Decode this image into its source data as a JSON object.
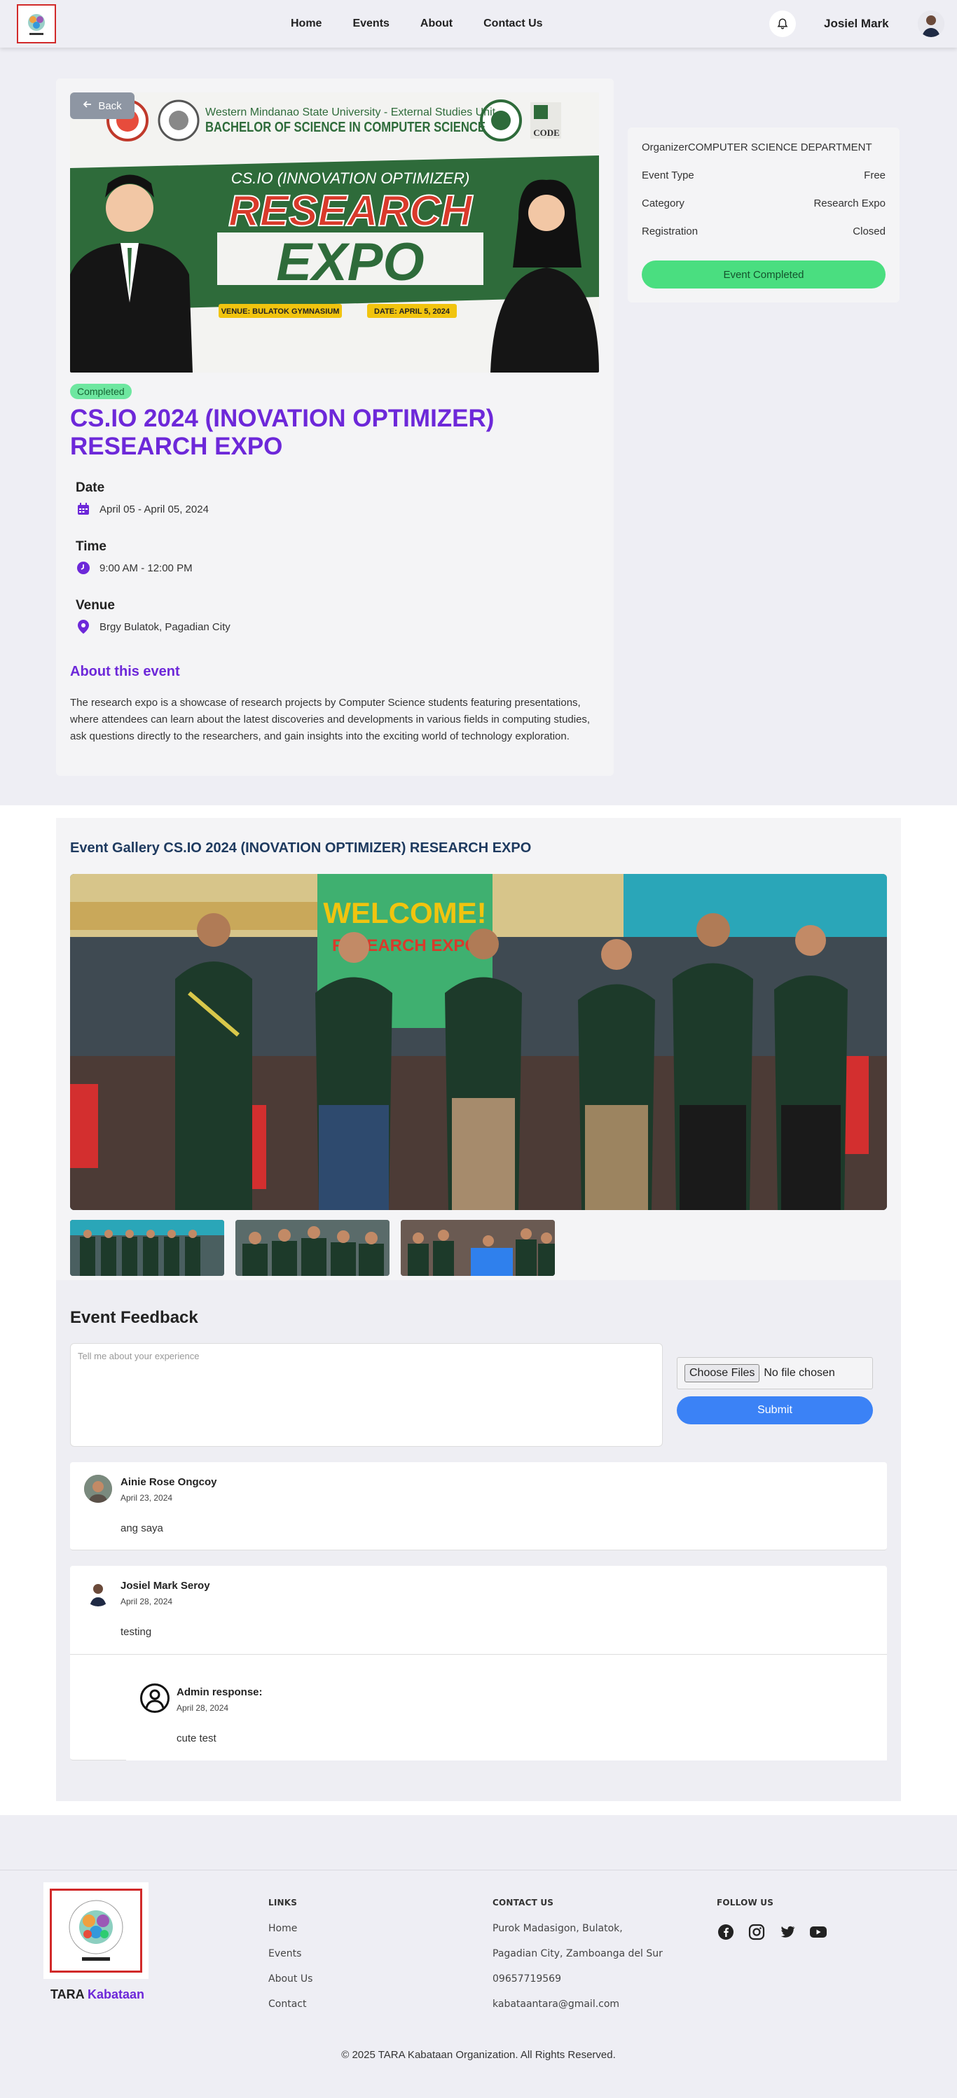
{
  "nav": {
    "links": [
      "Home",
      "Events",
      "About",
      "Contact Us"
    ],
    "user_name": "Josiel Mark"
  },
  "event": {
    "back_label": "Back",
    "status": "Completed",
    "title": "CS.IO 2024 (INOVATION OPTIMIZER) RESEARCH EXPO",
    "date_label": "Date",
    "date_value": "April 05 - April 05, 2024",
    "time_label": "Time",
    "time_value": "9:00 AM - 12:00 PM",
    "venue_label": "Venue",
    "venue_value": "Brgy Bulatok, Pagadian City",
    "about_title": "About this event",
    "about_text": "The research expo is a showcase of research projects by Computer Science students featuring presentations, where attendees can learn about the latest discoveries and developments in various fields in computing studies, ask questions directly to the researchers, and gain insights into the exciting world of technology exploration."
  },
  "banner": {
    "university": "Western Mindanao State University - External Studies Unit",
    "program": "BACHELOR OF SCIENCE IN COMPUTER SCIENCE",
    "subtitle": "CS.IO (INNOVATION OPTIMIZER)",
    "word1": "RESEARCH",
    "word2": "EXPO",
    "venue_tag": "VENUE: BULATOK GYMNASIUM",
    "date_tag": "DATE: APRIL 5, 2024",
    "code_logo": "CODE"
  },
  "details": {
    "organizer_label": "Organizer",
    "organizer_value": "COMPUTER SCIENCE DEPARTMENT",
    "type_label": "Event Type",
    "type_value": "Free",
    "category_label": "Category",
    "category_value": "Research Expo",
    "registration_label": "Registration",
    "registration_value": "Closed",
    "status_button": "Event Completed"
  },
  "gallery": {
    "title": "Event Gallery CS.IO 2024 (INOVATION OPTIMIZER) RESEARCH EXPO",
    "photo_banner_text": "WELCOME!",
    "photo_expo_text": "RESEARCH EXPO"
  },
  "feedback": {
    "title": "Event Feedback",
    "placeholder": "Tell me about your experience",
    "choose_files": "Choose Files",
    "no_file": "No file chosen",
    "submit": "Submit",
    "comments": [
      {
        "name": "Ainie Rose Ongcoy",
        "date": "April 23, 2024",
        "text": "ang saya"
      },
      {
        "name": "Josiel Mark Seroy",
        "date": "April 28, 2024",
        "text": "testing"
      }
    ],
    "reply": {
      "name": "Admin response:",
      "date": "April 28, 2024",
      "text": "cute test"
    }
  },
  "footer": {
    "brand_first": "TARA",
    "brand_second": "Kabataan",
    "links_title": "LINKS",
    "links": [
      "Home",
      "Events",
      "About Us",
      "Contact"
    ],
    "contact_title": "CONTACT US",
    "contact": [
      "Purok Madasigon, Bulatok,",
      "Pagadian City, Zamboanga del Sur",
      "09657719569",
      "kabataantara@gmail.com"
    ],
    "follow_title": "FOLLOW US",
    "copyright": "© 2025 TARA Kabataan Organization. All Rights Reserved."
  },
  "colors": {
    "accent": "#6d28d9",
    "success": "#4ade80",
    "primary": "#3b82f6",
    "banner_green": "#2e6b3a",
    "banner_red": "#d93a2b"
  }
}
